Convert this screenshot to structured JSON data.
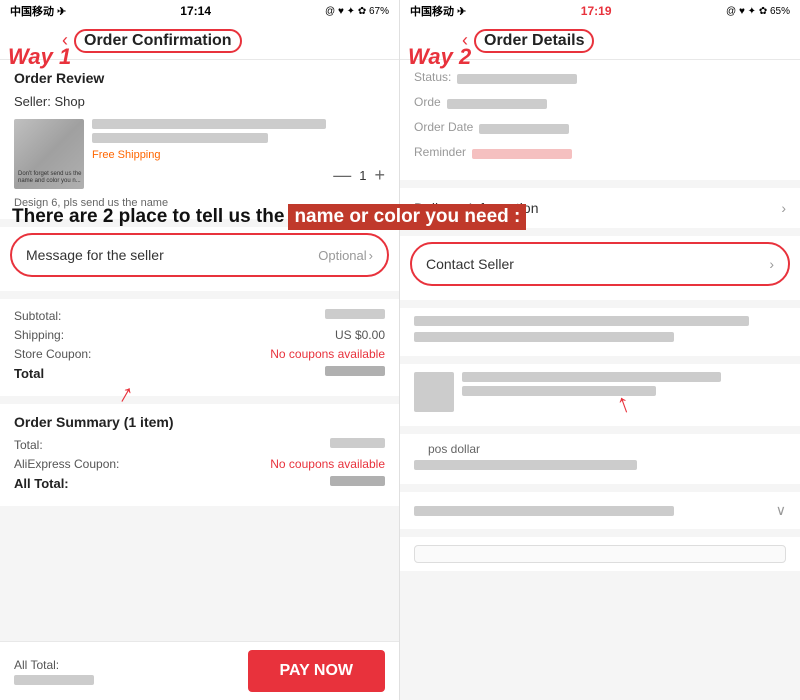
{
  "left": {
    "status_bar": {
      "carrier": "中国移动 ✈",
      "time": "17:14",
      "icons": "@ ♥ ✦ ✿ 67%"
    },
    "way_label": "Way 1",
    "nav_back": "‹",
    "nav_title": "Order Confirmation",
    "order_review_label": "Order Review",
    "seller_label": "Seller:  Shop",
    "free_shipping": "Free Shipping",
    "qty": "1",
    "design_note": "Design 6, pls send us the name",
    "message_seller_label": "Message for the seller",
    "message_optional": "Optional",
    "chevron": "›",
    "subtotal_label": "Subtotal:",
    "shipping_label": "Shipping:",
    "shipping_value": "US $0.00",
    "store_coupon_label": "Store Coupon:",
    "no_coupons": "No coupons available",
    "total_label": "Total",
    "order_summary_label": "Order Summary (1 item)",
    "total2_label": "Total:",
    "ali_coupon_label": "AliExpress Coupon:",
    "no_coupons2": "No coupons available",
    "all_total_label": "All Total:",
    "all_total2_label": "All Total:",
    "pay_now": "PAY NOW"
  },
  "right": {
    "status_bar": {
      "carrier": "中国移动 ✈",
      "time": "17:19",
      "icons": "@ ♥ ✦ ✿ 65%"
    },
    "way_label": "Way 2",
    "nav_back": "‹",
    "nav_title": "Order Details",
    "status_label": "Status:",
    "order_label": "Orde",
    "order_date_label": "Order Date",
    "reminder_label": "Reminder",
    "delivery_label": "Delivery Information",
    "chevron": "›",
    "contact_seller_label": "Contact Seller",
    "pos_dollar": "pos dollar"
  },
  "overlay": {
    "text_black": "There are 2 place to tell us the",
    "text_red": "name or color you need :"
  }
}
